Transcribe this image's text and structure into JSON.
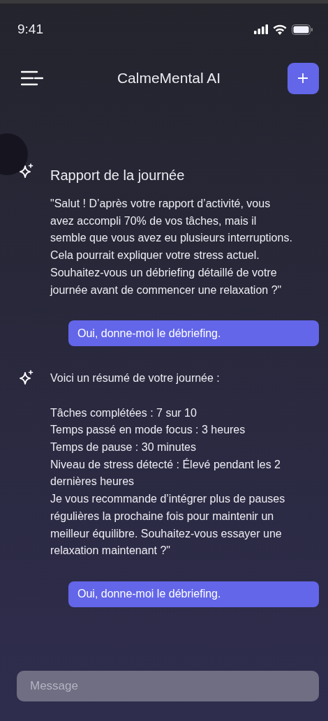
{
  "status_bar": {
    "time": "9:41"
  },
  "header": {
    "title": "CalmeMental AI"
  },
  "messages": [
    {
      "kind": "assistant",
      "title": "Rapport de la journée",
      "paragraphs": [
        "\"Salut ! D’après votre rapport d’activité, vous avez accompli 70% de vos tâches, mais il semble que vous avez eu plusieurs interruptions. Cela pourrait expliquer votre stress actuel. Souhaitez-vous un débriefing détaillé de votre journée avant de commencer une relaxation ?\""
      ]
    },
    {
      "kind": "user",
      "text": "Oui, donne-moi le débriefing."
    },
    {
      "kind": "assistant",
      "paragraphs": [
        "Voici un résumé de votre journée :",
        "Tâches complétées : 7 sur 10\nTemps passé en mode focus : 3 heures\nTemps de pause : 30 minutes\nNiveau de stress détecté : Élevé pendant les 2 dernières heures\nJe vous recommande d’intégrer plus de pauses régulières la prochaine fois pour maintenir un meilleur équilibre. Souhaitez-vous essayer une relaxation maintenant ?\""
      ]
    },
    {
      "kind": "user",
      "text": "Oui, donne-moi le débriefing."
    }
  ],
  "composer": {
    "placeholder": "Message"
  }
}
